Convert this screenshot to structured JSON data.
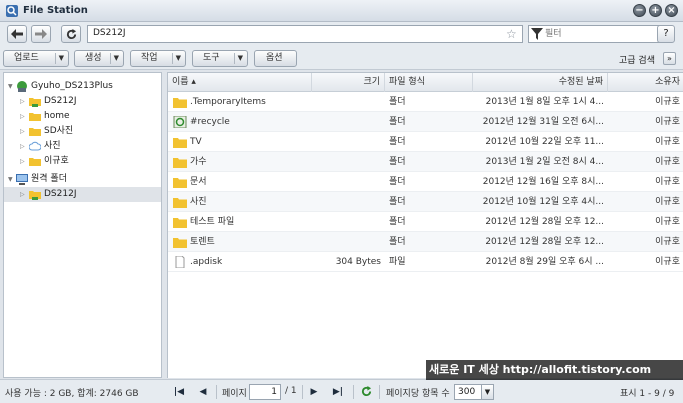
{
  "window": {
    "title": "File Station"
  },
  "nav": {
    "path": "DS212J",
    "filter_placeholder": "필터",
    "help": "?"
  },
  "toolbar": {
    "upload": "업로드",
    "create": "생성",
    "action": "작업",
    "tools": "도구",
    "settings": "옵션",
    "advanced_search": "고급 검색"
  },
  "sidebar": {
    "server": "Gyuho_DS213Plus",
    "items": [
      {
        "label": "DS212J",
        "icon": "shared-folder-icon"
      },
      {
        "label": "home",
        "icon": "folder-icon"
      },
      {
        "label": "SD사진",
        "icon": "folder-icon"
      },
      {
        "label": "사진",
        "icon": "cloud-icon"
      },
      {
        "label": "이규호",
        "icon": "folder-icon"
      }
    ],
    "remote_label": "원격 폴더",
    "remote_items": [
      {
        "label": "DS212J",
        "icon": "shared-folder-icon"
      }
    ]
  },
  "table": {
    "columns": [
      "이름 ▴",
      "크기",
      "파일 형식",
      "수정된 날짜",
      "소유자"
    ],
    "rows": [
      {
        "name": ".TemporaryItems",
        "size": "",
        "type": "폴더",
        "modified": "2013년 1월 8일 오후 1시 4...",
        "owner": "이규호",
        "icon": "folder"
      },
      {
        "name": "#recycle",
        "size": "",
        "type": "폴더",
        "modified": "2012년 12월 31일 오전 6시...",
        "owner": "이규호",
        "icon": "recycle"
      },
      {
        "name": "TV",
        "size": "",
        "type": "폴더",
        "modified": "2012년 10월 22일 오후 11...",
        "owner": "이규호",
        "icon": "folder"
      },
      {
        "name": "가수",
        "size": "",
        "type": "폴더",
        "modified": "2013년 1월 2일 오전 8시 4...",
        "owner": "이규호",
        "icon": "folder"
      },
      {
        "name": "문서",
        "size": "",
        "type": "폴더",
        "modified": "2012년 12월 16일 오후 8시...",
        "owner": "이규호",
        "icon": "folder"
      },
      {
        "name": "사진",
        "size": "",
        "type": "폴더",
        "modified": "2012년 10월 12일 오후 4시...",
        "owner": "이규호",
        "icon": "folder"
      },
      {
        "name": "테스트 파일",
        "size": "",
        "type": "폴더",
        "modified": "2012년 12월 28일 오후 12...",
        "owner": "이규호",
        "icon": "folder"
      },
      {
        "name": "토렌트",
        "size": "",
        "type": "폴더",
        "modified": "2012년 12월 28일 오후 12...",
        "owner": "이규호",
        "icon": "folder"
      },
      {
        "name": ".apdisk",
        "size": "304 Bytes",
        "type": "파일",
        "modified": "2012년 8월 29일 오후 6시 ...",
        "owner": "이규호",
        "icon": "file"
      }
    ]
  },
  "status": {
    "storage": "사용 가능 : 2 GB, 합계: 2746 GB",
    "page_label": "페이지",
    "page_value": "1",
    "page_total": "/ 1",
    "per_page_label": "페이지당 항목 수",
    "per_page_value": "300",
    "showing": "표시 1 - 9 / 9"
  },
  "watermark": "새로운 IT 세상 http://allofit.tistory.com",
  "colors": {
    "folder": "#f2c230",
    "accent": "#1f2d3d"
  }
}
